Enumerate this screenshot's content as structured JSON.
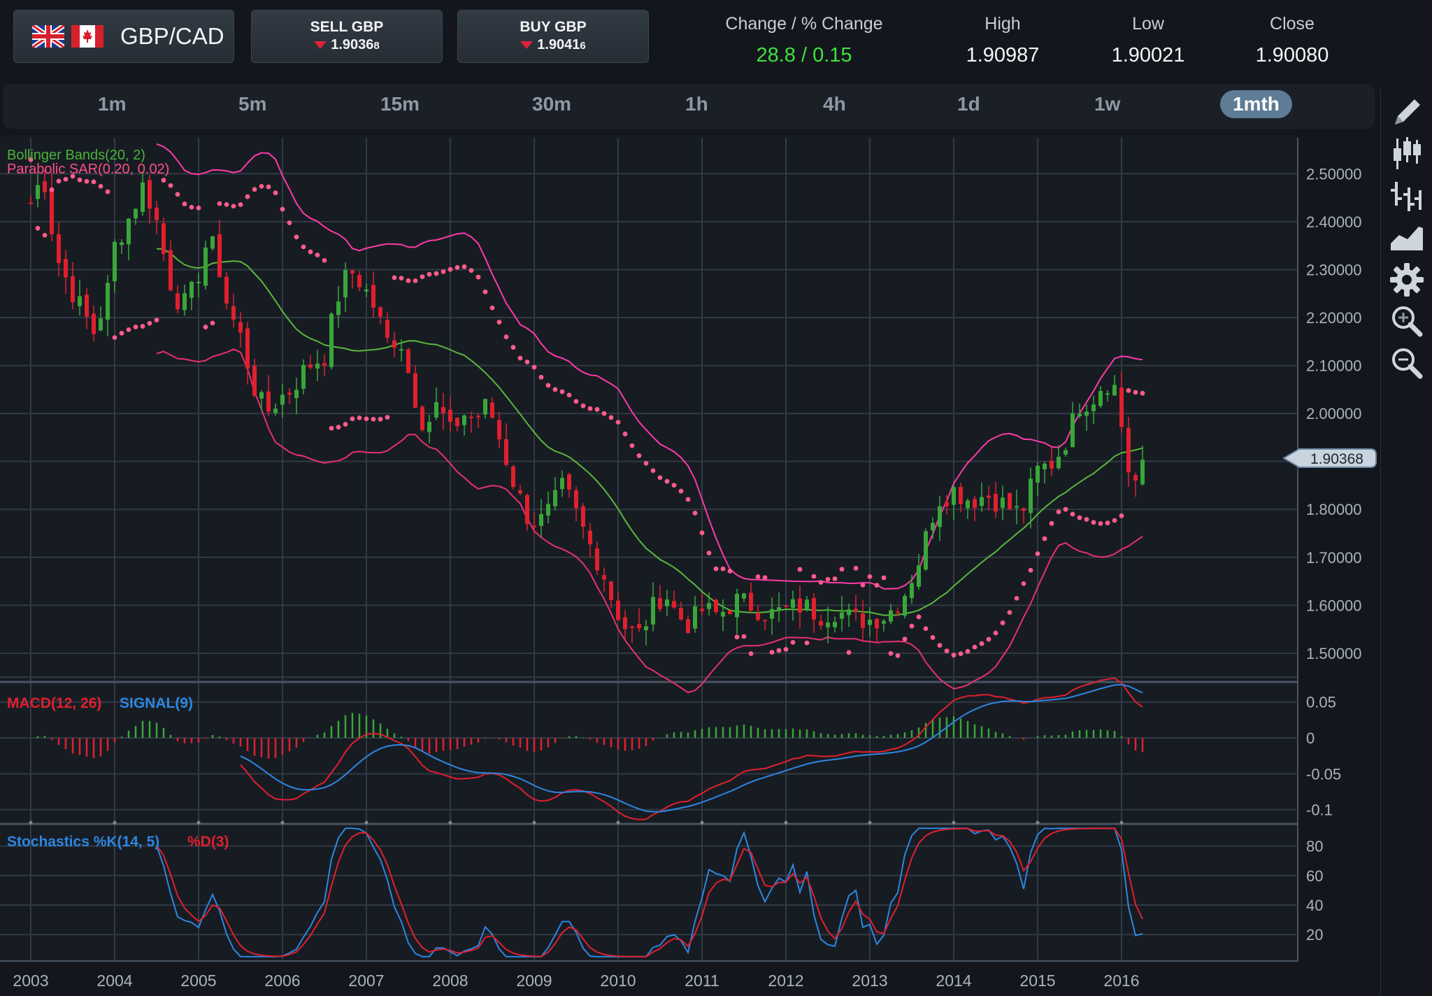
{
  "pair": {
    "label": "GBP/CAD",
    "flags": [
      "uk-flag-icon",
      "canada-flag-icon"
    ]
  },
  "sell": {
    "title": "SELL GBP",
    "price_main": "1.9036",
    "price_small": "8"
  },
  "buy": {
    "title": "BUY GBP",
    "price_main": "1.9041",
    "price_small": "6"
  },
  "stats": {
    "change_label": "Change / % Change",
    "change_value": "28.8 / 0.15",
    "high_label": "High",
    "high_value": "1.90987",
    "low_label": "Low",
    "low_value": "1.90021",
    "close_label": "Close",
    "close_value": "1.90080"
  },
  "timeframes": [
    "1m",
    "5m",
    "15m",
    "30m",
    "1h",
    "4h",
    "1d",
    "1w",
    "1mth"
  ],
  "active_timeframe": "1mth",
  "tools": [
    "pencil-icon",
    "candlestick-icon",
    "ohlc-bars-icon",
    "area-chart-icon",
    "settings-gear-icon",
    "zoom-in-icon",
    "zoom-out-icon"
  ],
  "colors": {
    "bull": "#3aa63a",
    "bear": "#e0202e",
    "bollinger": "#ff3aa8",
    "sma": "#58b83a",
    "sar": "#ff5c8a",
    "macd": "#e0202e",
    "signal": "#2d86e0",
    "accent": "#5f7c96"
  },
  "chart_data": [
    {
      "type": "candlestick",
      "indicators_text": [
        "Bollinger Bands(20, 2)",
        "Parabolic SAR(0.20, 0.02)"
      ],
      "y_ticks": [
        "2.50000",
        "2.40000",
        "2.30000",
        "2.20000",
        "2.10000",
        "2.00000",
        "1.80000",
        "1.70000",
        "1.60000",
        "1.50000"
      ],
      "ylim": [
        1.44,
        2.575
      ],
      "current_price_label": "1.90368",
      "current_price": 1.90368,
      "x_ticks": [
        "2003",
        "2004",
        "2005",
        "2006",
        "2007",
        "2008",
        "2009",
        "2010",
        "2011",
        "2012",
        "2013",
        "2014",
        "2015",
        "2016"
      ],
      "close_path": [
        [
          2003.0,
          2.44
        ],
        [
          2003.15,
          2.5
        ],
        [
          2003.3,
          2.33
        ],
        [
          2003.45,
          2.27
        ],
        [
          2003.6,
          2.22
        ],
        [
          2003.75,
          2.17
        ],
        [
          2003.9,
          2.24
        ],
        [
          2004.0,
          2.35
        ],
        [
          2004.15,
          2.4
        ],
        [
          2004.35,
          2.48
        ],
        [
          2004.5,
          2.4
        ],
        [
          2004.65,
          2.28
        ],
        [
          2004.8,
          2.22
        ],
        [
          2004.95,
          2.26
        ],
        [
          2005.1,
          2.36
        ],
        [
          2005.2,
          2.34
        ],
        [
          2005.35,
          2.22
        ],
        [
          2005.5,
          2.16
        ],
        [
          2005.65,
          2.06
        ],
        [
          2005.8,
          2.0
        ],
        [
          2005.95,
          2.03
        ],
        [
          2006.1,
          2.05
        ],
        [
          2006.3,
          2.1
        ],
        [
          2006.5,
          2.12
        ],
        [
          2006.65,
          2.24
        ],
        [
          2006.8,
          2.3
        ],
        [
          2006.95,
          2.27
        ],
        [
          2007.1,
          2.22
        ],
        [
          2007.25,
          2.15
        ],
        [
          2007.4,
          2.16
        ],
        [
          2007.55,
          2.05
        ],
        [
          2007.7,
          1.97
        ],
        [
          2007.85,
          2.02
        ],
        [
          2008.0,
          1.96
        ],
        [
          2008.15,
          2.0
        ],
        [
          2008.3,
          1.99
        ],
        [
          2008.45,
          2.02
        ],
        [
          2008.6,
          1.94
        ],
        [
          2008.75,
          1.86
        ],
        [
          2008.9,
          1.79
        ],
        [
          2009.05,
          1.77
        ],
        [
          2009.2,
          1.8
        ],
        [
          2009.35,
          1.85
        ],
        [
          2009.5,
          1.79
        ],
        [
          2009.65,
          1.73
        ],
        [
          2009.8,
          1.68
        ],
        [
          2009.95,
          1.6
        ],
        [
          2010.1,
          1.55
        ],
        [
          2010.25,
          1.54
        ],
        [
          2010.4,
          1.59
        ],
        [
          2010.55,
          1.63
        ],
        [
          2010.7,
          1.58
        ],
        [
          2010.85,
          1.56
        ],
        [
          2011.0,
          1.59
        ],
        [
          2011.2,
          1.58
        ],
        [
          2011.4,
          1.61
        ],
        [
          2011.6,
          1.6
        ],
        [
          2011.8,
          1.58
        ],
        [
          2012.0,
          1.59
        ],
        [
          2012.2,
          1.6
        ],
        [
          2012.4,
          1.58
        ],
        [
          2012.6,
          1.59
        ],
        [
          2012.8,
          1.57
        ],
        [
          2013.0,
          1.57
        ],
        [
          2013.2,
          1.58
        ],
        [
          2013.4,
          1.62
        ],
        [
          2013.6,
          1.7
        ],
        [
          2013.8,
          1.82
        ],
        [
          2014.0,
          1.84
        ],
        [
          2014.2,
          1.82
        ],
        [
          2014.4,
          1.83
        ],
        [
          2014.6,
          1.81
        ],
        [
          2014.8,
          1.79
        ],
        [
          2015.0,
          1.88
        ],
        [
          2015.2,
          1.9
        ],
        [
          2015.35,
          1.95
        ],
        [
          2015.5,
          2.02
        ],
        [
          2015.65,
          2.03
        ],
        [
          2015.8,
          2.07
        ],
        [
          2015.95,
          2.05
        ],
        [
          2016.05,
          1.9
        ],
        [
          2016.15,
          1.85
        ],
        [
          2016.25,
          1.9
        ]
      ]
    },
    {
      "type": "line",
      "label_macd": "MACD(12, 26)",
      "label_signal": "SIGNAL(9)",
      "y_ticks": [
        "0.05",
        "0",
        "-0.05",
        "-0.1"
      ],
      "ylim": [
        -0.112,
        0.078
      ]
    },
    {
      "type": "line",
      "label_k": "Stochastics %K(14, 5)",
      "label_d": "%D(3)",
      "y_ticks": [
        "80",
        "60",
        "40",
        "20"
      ],
      "ylim": [
        3,
        95
      ]
    }
  ]
}
